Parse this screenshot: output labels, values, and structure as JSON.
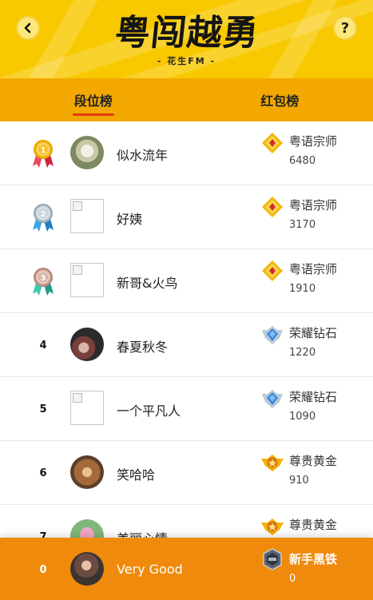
{
  "header": {
    "title": "粤闯越勇",
    "subtitle": "- 花生FM -",
    "back_icon": "chevron-left-icon",
    "help_label": "?",
    "color": "#f8c800"
  },
  "tabs": [
    {
      "label": "段位榜",
      "active": true
    },
    {
      "label": "红包榜",
      "active": false
    }
  ],
  "rows": [
    {
      "rank": "1",
      "medal": "gold",
      "name": "似水流年",
      "avatar": "photo-flower-white",
      "tier": "粤语宗师",
      "tier_icon": "master-badge-icon",
      "score": "6480"
    },
    {
      "rank": "2",
      "medal": "silver",
      "name": "好姨",
      "avatar": "broken",
      "tier": "粤语宗师",
      "tier_icon": "master-badge-icon",
      "score": "3170"
    },
    {
      "rank": "3",
      "medal": "bronze",
      "name": "新哥&火鸟",
      "avatar": "broken",
      "tier": "粤语宗师",
      "tier_icon": "master-badge-icon",
      "score": "1910"
    },
    {
      "rank": "4",
      "medal": "",
      "name": "春夏秋冬",
      "avatar": "photo-dark",
      "tier": "荣耀钻石",
      "tier_icon": "diamond-badge-icon",
      "score": "1220"
    },
    {
      "rank": "5",
      "medal": "",
      "name": "一个平凡人",
      "avatar": "broken",
      "tier": "荣耀钻石",
      "tier_icon": "diamond-badge-icon",
      "score": "1090"
    },
    {
      "rank": "6",
      "medal": "",
      "name": "笑哈哈",
      "avatar": "photo-warm",
      "tier": "尊贵黄金",
      "tier_icon": "gold-badge-icon",
      "score": "910"
    },
    {
      "rank": "7",
      "medal": "",
      "name": "美丽心情",
      "avatar": "photo-lotus",
      "tier": "尊贵黄金",
      "tier_icon": "gold-badge-icon",
      "score": ""
    }
  ],
  "me": {
    "rank": "0",
    "name": "Very Good",
    "avatar": "photo-person",
    "tier": "新手黑铁",
    "tier_icon": "iron-badge-icon",
    "score": "0",
    "color": "#f08a0c"
  }
}
